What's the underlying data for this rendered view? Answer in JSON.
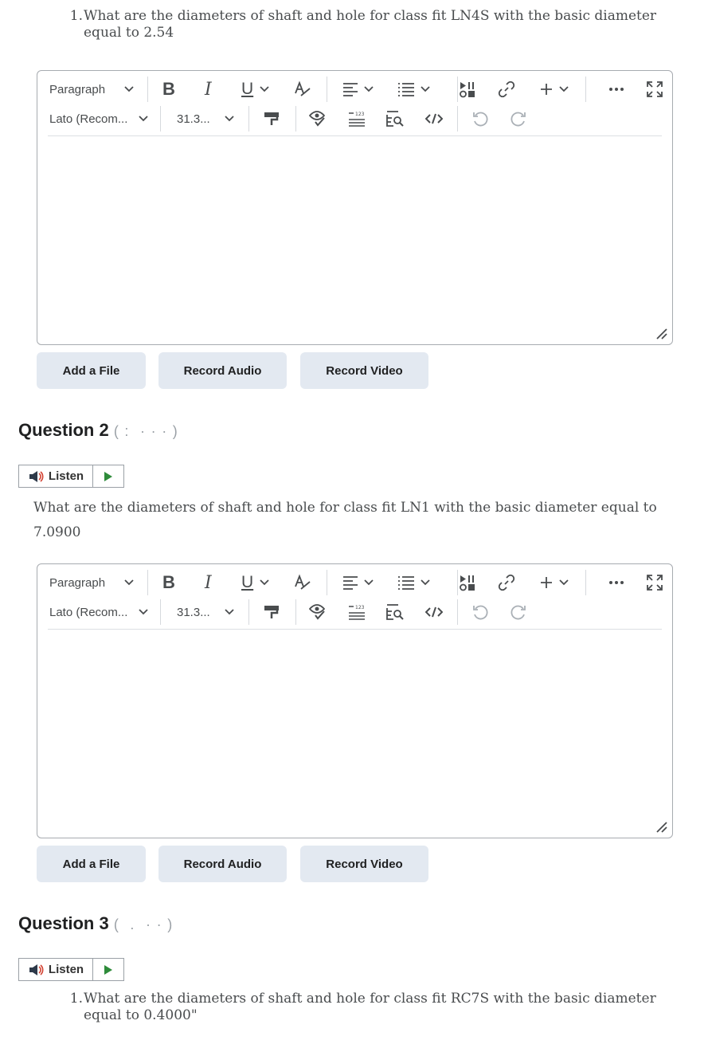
{
  "question1_part": {
    "number": "1.",
    "text_line1": "What are the diameters of shaft and hole for class fit  LN4S with the basic diameter",
    "text_line2": "equal to 2.54"
  },
  "editor": {
    "block_format": "Paragraph",
    "font_family": "Lato (Recom...",
    "font_size": "31.3...",
    "icons": [
      "bold-icon",
      "italic-icon",
      "underline-icon",
      "spellcheck-icon",
      "align-left-icon",
      "list-icon",
      "media-icon",
      "link-icon",
      "insert-plus-icon",
      "more-options-icon",
      "fullscreen-icon",
      "format-painter-icon",
      "accessibility-check-icon",
      "word-count-icon",
      "preview-icon",
      "source-code-icon",
      "undo-icon",
      "redo-icon"
    ]
  },
  "attach_buttons": {
    "add_file": "Add a File",
    "record_audio": "Record Audio",
    "record_video": "Record Video"
  },
  "question2": {
    "heading": "Question 2",
    "listen_label": "Listen",
    "text_line1": "What are the diameters of shaft and hole for class fit  LN1 with the basic diameter equal to",
    "text_line2": "7.0900"
  },
  "question3": {
    "heading": "Question 3",
    "listen_label": "Listen",
    "number": "1.",
    "text_line1": "What are the diameters of shaft and hole for class fit  RC7S with the basic diameter",
    "text_line2": "equal to 0.4000\""
  },
  "colors": {
    "button_bg": "#e3e9f1",
    "border": "#a7abb0",
    "play_green": "#2e8b3a"
  }
}
